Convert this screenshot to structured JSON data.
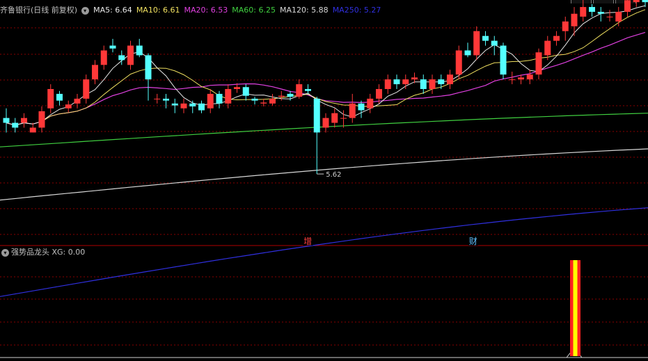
{
  "main_panel": {
    "stock_name": "齐鲁银行",
    "period": "(日线 前复权)",
    "indicators": [
      {
        "label": "MA5: 6.64",
        "color": "#e8e8e8"
      },
      {
        "label": "MA10: 6.61",
        "color": "#f0e060"
      },
      {
        "label": "MA20: 6.53",
        "color": "#e040e0"
      },
      {
        "label": "MA60: 6.25",
        "color": "#40d040"
      },
      {
        "label": "MA120: 5.88",
        "color": "#d8d8d8"
      },
      {
        "label": "MA250: 5.27",
        "color": "#3030e0"
      }
    ],
    "low_marker": "5.62",
    "events": [
      "增",
      "财"
    ]
  },
  "sub_panel": {
    "indicator_name": "强势品龙头",
    "value_label": "XG: 0.00"
  },
  "colors": {
    "up": "#ff3838",
    "down": "#54ffff",
    "grid": "#8a0000",
    "divider": "#b00000",
    "signal_outer": "#ff2020",
    "signal_inner": "#ffff00"
  },
  "chart_data": {
    "type": "candlestick",
    "ylim": [
      4.9,
      7.3
    ],
    "candles": [
      [
        6.2,
        6.15,
        6.3,
        6.05
      ],
      [
        6.15,
        6.1,
        6.2,
        6.05
      ],
      [
        6.15,
        6.2,
        6.25,
        6.1
      ],
      [
        6.05,
        6.1,
        6.15,
        6.05
      ],
      [
        6.1,
        6.27,
        6.32,
        6.05
      ],
      [
        6.3,
        6.5,
        6.55,
        6.25
      ],
      [
        6.45,
        6.38,
        6.48,
        6.33
      ],
      [
        6.3,
        6.34,
        6.38,
        6.26
      ],
      [
        6.35,
        6.4,
        6.45,
        6.3
      ],
      [
        6.4,
        6.6,
        6.65,
        6.35
      ],
      [
        6.6,
        6.75,
        6.8,
        6.55
      ],
      [
        6.75,
        6.9,
        6.95,
        6.7
      ],
      [
        6.95,
        6.92,
        7.02,
        6.88
      ],
      [
        6.85,
        6.8,
        6.9,
        6.75
      ],
      [
        6.75,
        6.95,
        7.0,
        6.7
      ],
      [
        6.95,
        6.85,
        7.02,
        6.83
      ],
      [
        6.85,
        6.6,
        6.87,
        6.38
      ],
      [
        6.4,
        6.4,
        6.45,
        6.35
      ],
      [
        6.4,
        6.38,
        6.45,
        6.3
      ],
      [
        6.35,
        6.33,
        6.4,
        6.25
      ],
      [
        6.3,
        6.35,
        6.4,
        6.25
      ],
      [
        6.35,
        6.32,
        6.38,
        6.25
      ],
      [
        6.35,
        6.28,
        6.38,
        6.25
      ],
      [
        6.3,
        6.45,
        6.5,
        6.25
      ],
      [
        6.45,
        6.35,
        6.48,
        6.3
      ],
      [
        6.35,
        6.5,
        6.55,
        6.3
      ],
      [
        6.5,
        6.52,
        6.56,
        6.46
      ],
      [
        6.52,
        6.43,
        6.55,
        6.38
      ],
      [
        6.4,
        6.38,
        6.42,
        6.34
      ],
      [
        6.35,
        6.36,
        6.4,
        6.32
      ],
      [
        6.35,
        6.4,
        6.45,
        6.33
      ],
      [
        6.42,
        6.43,
        6.48,
        6.38
      ],
      [
        6.45,
        6.42,
        6.48,
        6.38
      ],
      [
        6.42,
        6.55,
        6.6,
        6.4
      ],
      [
        6.5,
        6.48,
        6.55,
        6.45
      ],
      [
        6.4,
        6.05,
        6.42,
        5.62
      ],
      [
        6.1,
        6.2,
        6.25,
        6.05
      ],
      [
        6.15,
        6.25,
        6.3,
        6.1
      ],
      [
        6.2,
        6.2,
        6.28,
        6.1
      ],
      [
        6.2,
        6.35,
        6.45,
        6.15
      ],
      [
        6.35,
        6.28,
        6.38,
        6.2
      ],
      [
        6.3,
        6.4,
        6.45,
        6.25
      ],
      [
        6.4,
        6.5,
        6.55,
        6.35
      ],
      [
        6.5,
        6.6,
        6.65,
        6.45
      ],
      [
        6.6,
        6.55,
        6.65,
        6.5
      ],
      [
        6.55,
        6.6,
        6.65,
        6.5
      ],
      [
        6.6,
        6.62,
        6.67,
        6.56
      ],
      [
        6.6,
        6.5,
        6.65,
        6.45
      ],
      [
        6.5,
        6.6,
        6.65,
        6.45
      ],
      [
        6.6,
        6.55,
        6.65,
        6.5
      ],
      [
        6.55,
        6.65,
        6.7,
        6.5
      ],
      [
        6.65,
        6.9,
        6.95,
        6.6
      ],
      [
        6.9,
        6.85,
        6.98,
        6.83
      ],
      [
        6.85,
        7.1,
        7.15,
        6.8
      ],
      [
        7.05,
        7.0,
        7.1,
        6.95
      ],
      [
        7.0,
        6.95,
        7.05,
        6.85
      ],
      [
        6.95,
        6.65,
        6.98,
        6.6
      ],
      [
        6.6,
        6.6,
        6.68,
        6.55
      ],
      [
        6.6,
        6.62,
        6.65,
        6.55
      ],
      [
        6.6,
        6.65,
        6.7,
        6.55
      ],
      [
        6.65,
        6.88,
        6.92,
        6.6
      ],
      [
        6.85,
        7.0,
        7.05,
        6.8
      ],
      [
        7.0,
        7.05,
        7.1,
        6.95
      ],
      [
        7.1,
        7.2,
        7.25,
        7.0
      ],
      [
        7.15,
        7.28,
        7.35,
        7.05
      ],
      [
        7.25,
        7.35,
        7.45,
        7.2
      ],
      [
        7.35,
        7.3,
        7.38,
        7.25
      ],
      [
        7.3,
        7.28,
        7.35,
        7.2
      ],
      [
        7.25,
        7.25,
        7.32,
        7.2
      ],
      [
        7.2,
        7.3,
        7.35,
        7.15
      ],
      [
        7.3,
        7.42,
        7.48,
        7.25
      ],
      [
        7.4,
        7.45,
        7.5,
        7.35
      ],
      [
        7.45,
        7.4,
        7.5,
        7.35
      ]
    ],
    "ma250": [
      4.35,
      5.27
    ],
    "ma120": [
      5.35,
      5.88
    ],
    "ma60": [
      5.9,
      6.25
    ],
    "signal_index": 64
  }
}
